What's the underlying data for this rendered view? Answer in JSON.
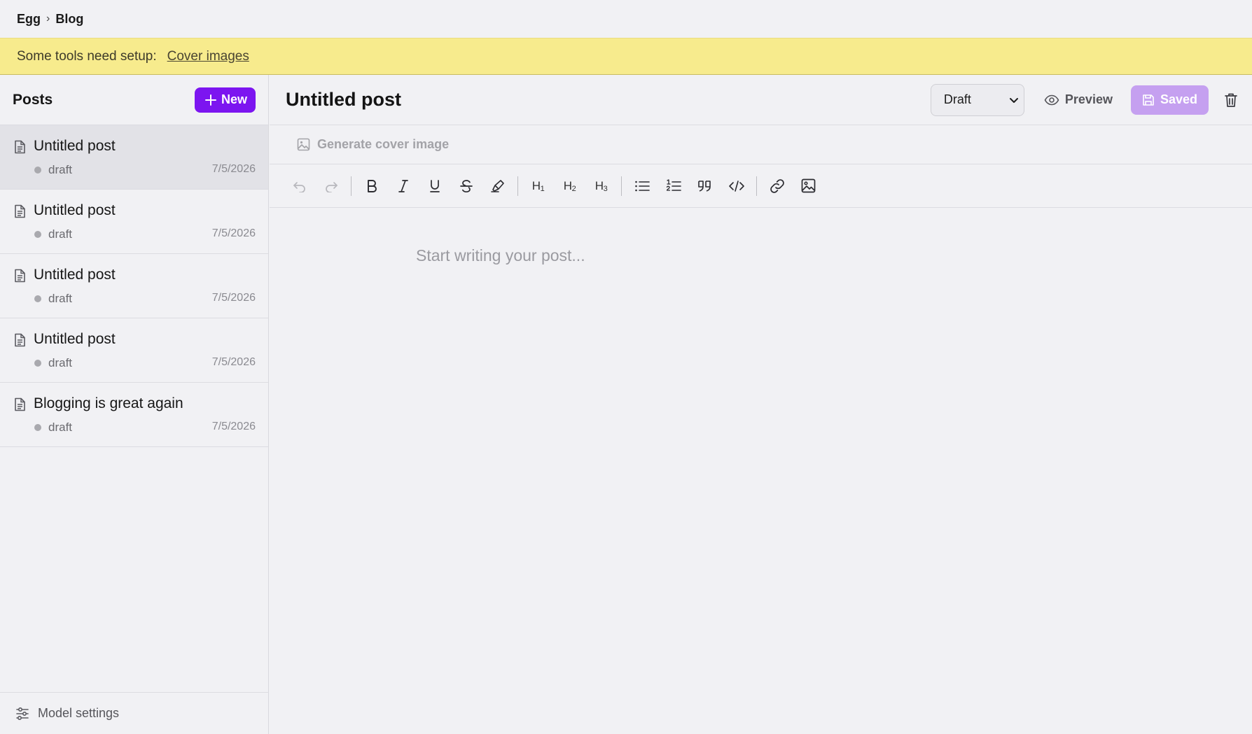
{
  "breadcrumb": {
    "workspace": "Egg",
    "separator": "›",
    "section": "Blog"
  },
  "banner": {
    "message": "Some tools need setup:",
    "link": "Cover images"
  },
  "sidebar": {
    "title": "Posts",
    "new_label": "New",
    "posts": [
      {
        "title": "Untitled post",
        "status": "draft",
        "date": "7/5/2026",
        "active": true
      },
      {
        "title": "Untitled post",
        "status": "draft",
        "date": "7/5/2026",
        "active": false
      },
      {
        "title": "Untitled post",
        "status": "draft",
        "date": "7/5/2026",
        "active": false
      },
      {
        "title": "Untitled post",
        "status": "draft",
        "date": "7/5/2026",
        "active": false
      },
      {
        "title": "Blogging is great again",
        "status": "draft",
        "date": "7/5/2026",
        "active": false
      }
    ],
    "footer_label": "Model settings"
  },
  "editor": {
    "title": "Untitled post",
    "status_select": {
      "selected": "Draft"
    },
    "preview_label": "Preview",
    "saved_label": "Saved",
    "cover_label": "Generate cover image",
    "placeholder": "Start writing your post...",
    "toolbar": {
      "h1": "H",
      "h2": "H",
      "h3": "H",
      "h1_sub": "1",
      "h2_sub": "2",
      "h3_sub": "3"
    }
  },
  "colors": {
    "accent": "#7c15f0",
    "accent_disabled": "#c5a0f0",
    "banner": "#f7eb8d",
    "background": "#f1f1f4",
    "active_item": "#e2e2e7"
  },
  "icons": {
    "posts": "document-icon",
    "new": "plus-icon",
    "footer": "sliders-icon",
    "preview": "eye-icon",
    "saved": "save-icon",
    "delete": "trash-icon",
    "cover": "image-icon"
  }
}
